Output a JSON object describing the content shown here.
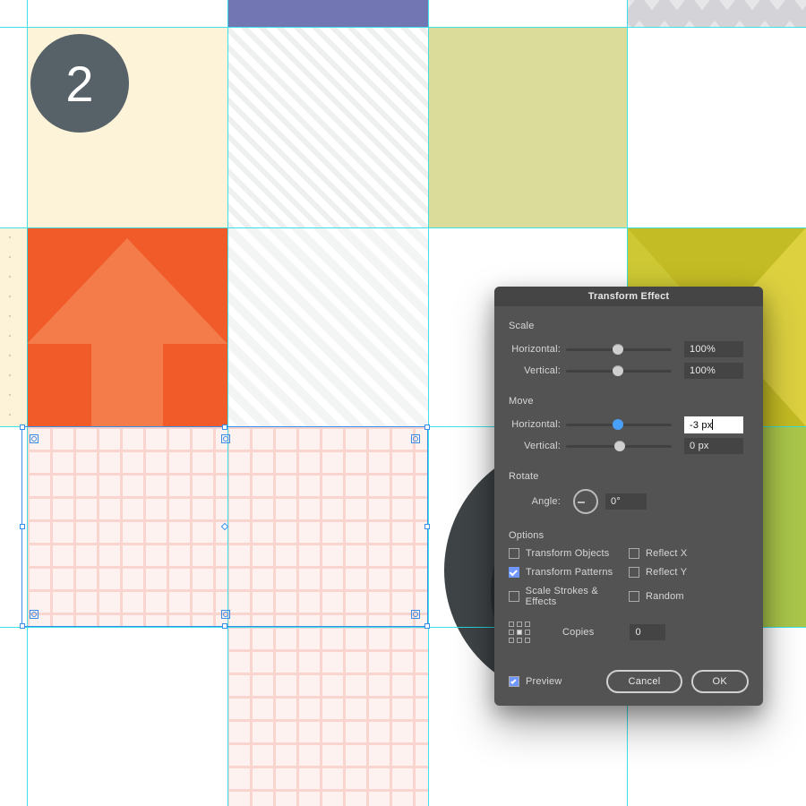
{
  "step_number": "2",
  "dialog": {
    "title": "Transform Effect",
    "scale": {
      "section": "Scale",
      "horizontal_label": "Horizontal:",
      "horizontal_value": "100%",
      "vertical_label": "Vertical:",
      "vertical_value": "100%"
    },
    "move": {
      "section": "Move",
      "horizontal_label": "Horizontal:",
      "horizontal_value": "-3 px",
      "vertical_label": "Vertical:",
      "vertical_value": "0 px"
    },
    "rotate": {
      "section": "Rotate",
      "angle_label": "Angle:",
      "angle_value": "0°"
    },
    "options": {
      "section": "Options",
      "transform_objects": {
        "label": "Transform Objects",
        "checked": false
      },
      "reflect_x": {
        "label": "Reflect X",
        "checked": false
      },
      "transform_patterns": {
        "label": "Transform Patterns",
        "checked": true
      },
      "reflect_y": {
        "label": "Reflect Y",
        "checked": false
      },
      "scale_strokes": {
        "label": "Scale Strokes & Effects",
        "checked": false
      },
      "random": {
        "label": "Random",
        "checked": false
      }
    },
    "copies": {
      "label": "Copies",
      "value": "0"
    },
    "preview": {
      "label": "Preview",
      "checked": true
    },
    "cancel": "Cancel",
    "ok": "OK"
  },
  "tiles": {
    "purple": "purple-tile",
    "zig": "zigzag-tile",
    "cream": "cream-tile",
    "diag1": "diagonal-1",
    "olive": "olive-tile",
    "dots": "dotted-tile",
    "orange_arrow": "orange-arrow-tile",
    "diag2": "diagonal-2",
    "mustard": "mustard-triangles",
    "pink": "pink-grid-tile",
    "record": "vinyl-record-tile",
    "yellowgreen": "yellowgreen-tile"
  }
}
